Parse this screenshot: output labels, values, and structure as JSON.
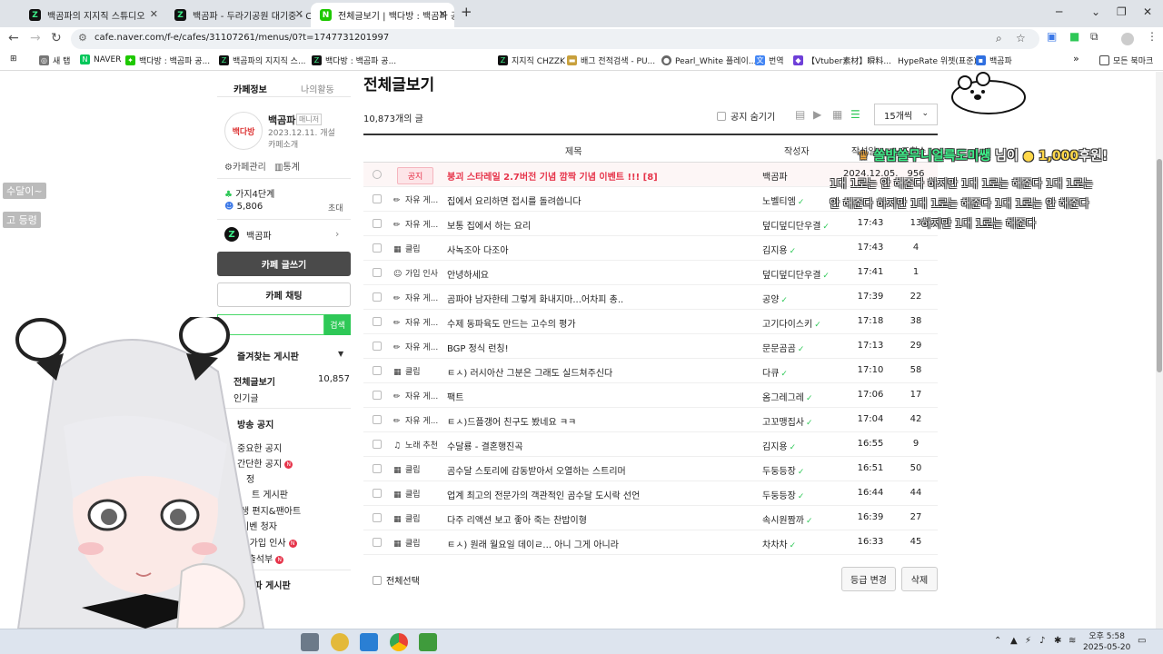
{
  "tabs": [
    {
      "title": "백곰파의 지지직 스튜디오",
      "active": false
    },
    {
      "title": "백곰파 - 두라기공원 대기중 - C",
      "active": false
    },
    {
      "title": "전체글보기 | 백다방 : 백곰파 공",
      "active": true
    }
  ],
  "toolbar": {
    "url": "cafe.naver.com/f-e/cafes/31107261/menus/0?t=1747731201997"
  },
  "bookmarks": [
    {
      "label": "새 탭",
      "color": "#777777"
    },
    {
      "label": "NAVER",
      "color": "#03c75a"
    },
    {
      "label": "백다방 : 백곰파 공...",
      "color": "#1ec800"
    },
    {
      "label": "백곰파의 지지직 스...",
      "color": "#111111"
    },
    {
      "label": "백다방 : 백곰파 공...",
      "color": "#111111"
    },
    {
      "label": "지지직 CHZZK",
      "color": "#111111"
    },
    {
      "label": "배그 전적검색 - PU...",
      "color": "#c8a03c"
    },
    {
      "label": "Pearl_White 플레이...",
      "color": "#666666"
    },
    {
      "label": "번역",
      "color": "#4285f4"
    },
    {
      "label": "【Vtuber素材】瞬料...",
      "color": "#6e3fd8"
    },
    {
      "label": "HypeRate 위젯(표준)",
      "color": "#ffffff"
    },
    {
      "label": "백곰파",
      "color": "#2f6fe0"
    }
  ],
  "bookmarks_all": "모든 북마크",
  "sidebar": {
    "tab_info": "카페정보",
    "tab_activity": "나의활동",
    "cafe_name": "백곰파",
    "manager_badge": "매니저",
    "created": "2023.12.11. 개설",
    "intro": "카페소개",
    "manage": "카페관리",
    "stats": "통계",
    "level": "가지4단계",
    "members": "5,806",
    "invite": "초대",
    "owner": "백곰파",
    "logo_text": "백다방",
    "write_button": "카페 글쓰기",
    "chat_button": "카페 채팅",
    "search_button": "검색",
    "favorites_header": "즐겨찾는 게시판",
    "all_posts": "전체글보기",
    "all_posts_count": "10,857",
    "popular": "인기글",
    "broadcast_notice": "방송 공지",
    "important_notice": "중요한 공지",
    "simple_notice": "간단한 공지",
    "schedule": "정",
    "board_partial": "트 게시판",
    "saeng_partial": "생 편지&팬아트",
    "event_partial": "이벤 청자",
    "join_greeting": "가입 인사",
    "attendance": "출석부",
    "baekgompa_board": "백곰파 게시판"
  },
  "main": {
    "title": "전체글보기",
    "post_count": "10,873개의 글",
    "hide_notice": "공지 숨기기",
    "per_page": "15개씩",
    "col_title": "제목",
    "col_author": "작성자",
    "col_date": "작성일",
    "col_views": "조회수",
    "select_all": "전체선택",
    "grade_change": "등급 변경",
    "delete": "삭제"
  },
  "rows": [
    {
      "notice": true,
      "cat": "공지",
      "icon": "",
      "title": "붕괴 스타레일 2.7버전 기념 깜짝 기념 이벤트 !!! [8]",
      "author": "백곰파",
      "date": "2024.12.05.",
      "views": "956"
    },
    {
      "notice": false,
      "cat": "자유 게...",
      "icon": "✏",
      "title": "집에서 요리하면 접시를 돌려씁니다",
      "author": "노벨티엠",
      "date": "",
      "views": ""
    },
    {
      "notice": false,
      "cat": "자유 게...",
      "icon": "✏",
      "title": "보통 집에서 하는 요리",
      "author": "덮디덮디단우결",
      "date": "17:43",
      "views": "13"
    },
    {
      "notice": false,
      "cat": "클립",
      "icon": "▦",
      "title": "사녹조아 다조아",
      "author": "김지용",
      "date": "17:43",
      "views": "4"
    },
    {
      "notice": false,
      "cat": "가입 인사",
      "icon": "☺",
      "title": "안녕하세요",
      "author": "덮디덮디단우결",
      "date": "17:41",
      "views": "1"
    },
    {
      "notice": false,
      "cat": "자유 게...",
      "icon": "✏",
      "title": "곰파야 남자한테 그렇게 화내지마...어차피 총..",
      "author": "공양",
      "date": "17:39",
      "views": "22"
    },
    {
      "notice": false,
      "cat": "자유 게...",
      "icon": "✏",
      "title": "수제 동파육도 만드는 고수의 평가",
      "author": "고기다이스키",
      "date": "17:18",
      "views": "38"
    },
    {
      "notice": false,
      "cat": "자유 게...",
      "icon": "✏",
      "title": "BGP 정식 런칭!",
      "author": "문문곰곰",
      "date": "17:13",
      "views": "29"
    },
    {
      "notice": false,
      "cat": "클립",
      "icon": "▦",
      "title": "ㅌㅅ) 러시아산 그분은 그래도 실드쳐주신다",
      "author": "다큐",
      "date": "17:10",
      "views": "58"
    },
    {
      "notice": false,
      "cat": "자유 게...",
      "icon": "✏",
      "title": "팩트",
      "author": "옴그레그레",
      "date": "17:06",
      "views": "17"
    },
    {
      "notice": false,
      "cat": "자유 게...",
      "icon": "✏",
      "title": "ㅌㅅ)드플갱어 친구도 봤네요 ㅋㅋ",
      "author": "고꼬맹집사",
      "date": "17:04",
      "views": "42"
    },
    {
      "notice": false,
      "cat": "노래 추천",
      "icon": "♫",
      "title": "수달룡 - 결혼행진곡",
      "author": "김지용",
      "date": "16:55",
      "views": "9"
    },
    {
      "notice": false,
      "cat": "클립",
      "icon": "▦",
      "title": "곰수달 스토리에 감동받아서 오열하는 스트리머",
      "author": "두둥등장",
      "date": "16:51",
      "views": "50"
    },
    {
      "notice": false,
      "cat": "클립",
      "icon": "▦",
      "title": "업계 최고의 전문가의 객관적인 곰수달 도시락 선언",
      "author": "두둥등장",
      "date": "16:44",
      "views": "44"
    },
    {
      "notice": false,
      "cat": "클립",
      "icon": "▦",
      "title": "다주 리액션 보고 좋아 죽는 찬밥이형",
      "author": "속시원짬까",
      "date": "16:39",
      "views": "27"
    },
    {
      "notice": false,
      "cat": "클립",
      "icon": "▦",
      "title": "ㅌㅅ) 원래 월요일 데이ㄹ... 아니 그게 아니라",
      "author": "차차차",
      "date": "16:33",
      "views": "45"
    }
  ],
  "overlay": {
    "chat": [
      "수달이~",
      "고 등령"
    ],
    "donor": "쏠밤쏠무니얼륵도미쌩",
    "donor_suffix": " 님이 ",
    "amount": "1,000",
    "amount_suffix": "후원!",
    "message_lines": [
      "1대 1로는 안 해준다 하지만 1대 1로는 해준다 1대 1로는",
      "안 해준다 하지만 1대 1로는 해준다 1대 1로는 안 해준다",
      "하지만 1대 1로는 해준다"
    ]
  },
  "taskbar": {
    "time": "오후 5:58",
    "date": "2025-05-20"
  },
  "colors": {
    "accent": "#2ec857",
    "notice": "#e6344a"
  }
}
